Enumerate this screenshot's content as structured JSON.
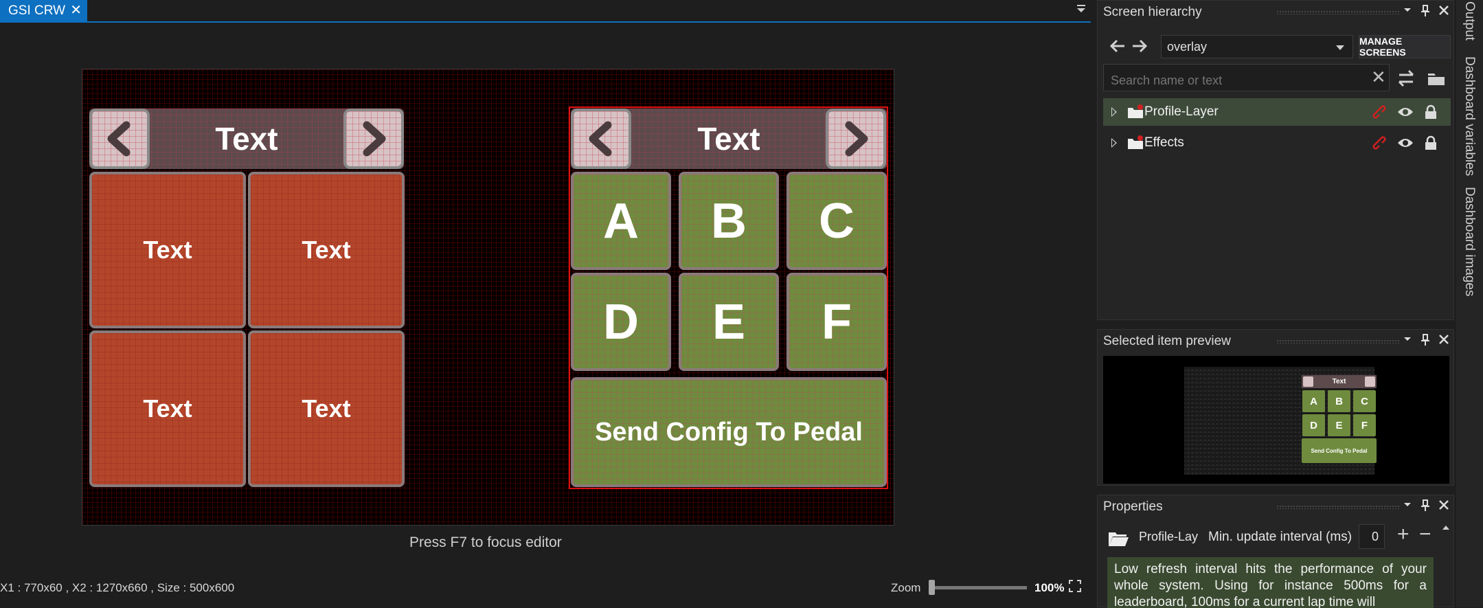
{
  "editor": {
    "tab_title": "GSI CRW",
    "tab_close": "✕",
    "hint": "Press F7 to focus editor",
    "status": {
      "coords": "X1 : 770x60 , X2 : 1270x660 , Size : 500x600",
      "zoom_label": "Zoom",
      "zoom_value": "100%",
      "zoom_level_percent": 0
    },
    "left_panel": {
      "header": "Text",
      "cells": [
        "Text",
        "Text",
        "Text",
        "Text"
      ]
    },
    "right_panel": {
      "header": "Text",
      "keys": [
        "A",
        "B",
        "C",
        "D",
        "E",
        "F"
      ],
      "send_button": "Send Config To Pedal"
    },
    "colors": {
      "red_cell": "#b3462a",
      "green_cell": "#6f8b3e",
      "selection": "#e01010",
      "accent": "#0e70c0"
    }
  },
  "hierarchy": {
    "title": "Screen hierarchy",
    "screen": "overlay",
    "manage_label": "MANAGE SCREENS",
    "search_placeholder": "Search name or text",
    "layers": [
      {
        "label": "Profile-Layer",
        "selected": true
      },
      {
        "label": "Effects",
        "selected": false
      }
    ]
  },
  "preview": {
    "title": "Selected item preview",
    "header": "Text",
    "keys": [
      "A",
      "B",
      "C",
      "D",
      "E",
      "F"
    ],
    "send_button": "Send Config To Pedal"
  },
  "properties": {
    "title": "Properties",
    "name": "Profile-Layer",
    "interval_label": "Min. update interval (ms)",
    "interval_value": "0",
    "warning": "Low refresh interval hits the performance of your whole system. Using for instance 500ms for a leaderboard, 100ms for a current lap time will"
  },
  "side_tabs": [
    "Output",
    "Dashboard variables",
    "Dashboard images"
  ],
  "icons": [
    "close-icon",
    "menu-icon",
    "chevron-left-icon",
    "chevron-right-icon",
    "arrow-left-icon",
    "arrow-right-icon",
    "swap-icon",
    "folder-icon",
    "link-icon",
    "eye-icon",
    "lock-icon",
    "pin-icon",
    "plus-icon",
    "minus-icon",
    "fit-icon"
  ]
}
